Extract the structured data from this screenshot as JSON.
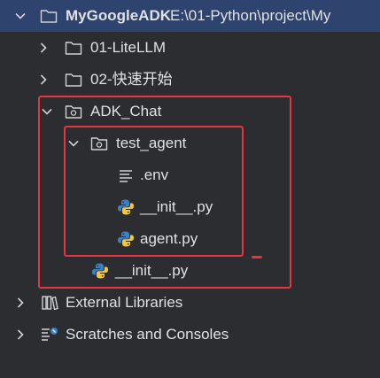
{
  "tree": {
    "root": {
      "label": "MyGoogleADK",
      "path": "E:\\01-Python\\project\\My"
    },
    "items": [
      {
        "label": "01-LiteLLM"
      },
      {
        "label": "02-快速开始"
      },
      {
        "label": "ADK_Chat"
      },
      {
        "label": "test_agent"
      },
      {
        "label": ".env"
      },
      {
        "label": "__init__.py"
      },
      {
        "label": "agent.py"
      },
      {
        "label": "__init__.py"
      },
      {
        "label": "External Libraries"
      },
      {
        "label": "Scratches and Consoles"
      }
    ]
  },
  "icons": {
    "chevron_down": "chevron-down-icon",
    "chevron_right": "chevron-right-icon",
    "folder": "folder-icon",
    "package_folder": "package-folder-icon",
    "text_file": "text-file-icon",
    "python_file": "python-file-icon",
    "library": "library-icon",
    "scratches": "scratches-icon"
  },
  "colors": {
    "background": "#2b2d30",
    "selected_row": "#2e436e",
    "text": "#dfe1e5",
    "annotation_red": "#e8343c",
    "python_blue": "#3e7fc1",
    "python_yellow": "#f5c53a"
  }
}
